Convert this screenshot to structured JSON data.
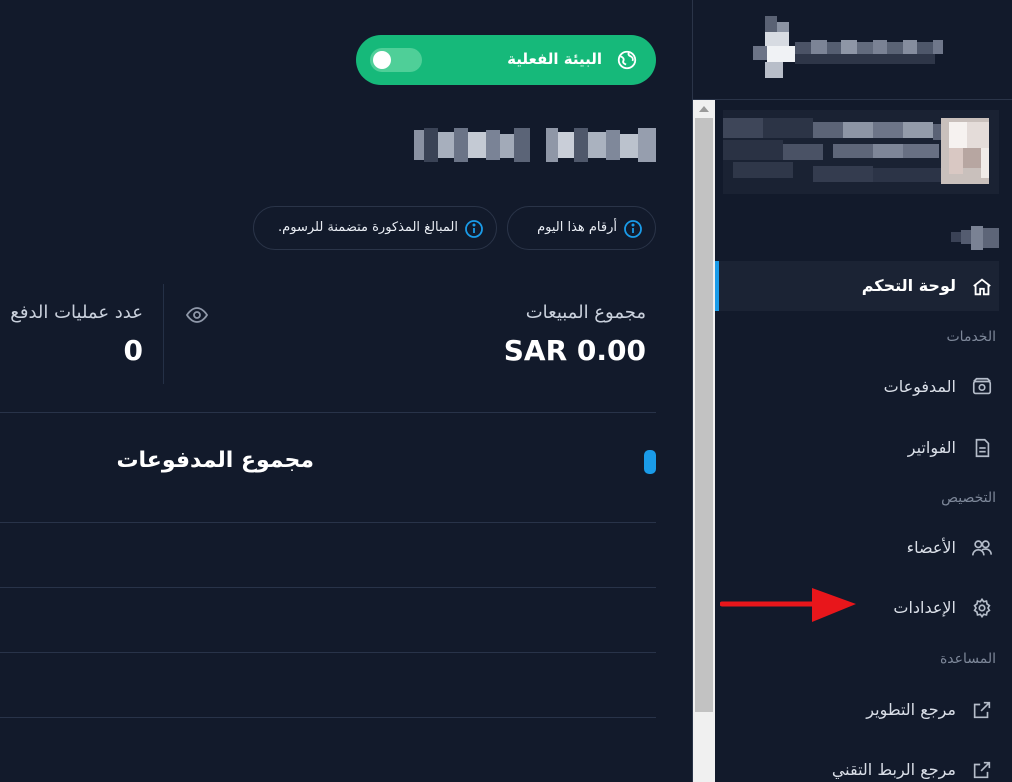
{
  "environment": {
    "label": "البيئة الفعلية",
    "toggle_on": false
  },
  "info_chips": [
    {
      "text": "أرقام هذا اليوم"
    },
    {
      "text": "المبالغ المذكورة متضمنة للرسوم."
    }
  ],
  "stats": {
    "sales_label": "مجموع المبيعات",
    "sales_value": "SAR 0.00",
    "count_label": "عدد عمليات الدفع",
    "count_value": "0"
  },
  "payments_section": {
    "title": "مجموع المدفوعات"
  },
  "sidebar": {
    "items": [
      {
        "label": "لوحة التحكم",
        "icon": "home-icon",
        "active": true
      },
      {
        "section": "الخدمات"
      },
      {
        "label": "المدفوعات",
        "icon": "payments-icon"
      },
      {
        "label": "الفواتير",
        "icon": "invoice-icon"
      },
      {
        "section": "التخصيص"
      },
      {
        "label": "الأعضاء",
        "icon": "members-icon"
      },
      {
        "label": "الإعدادات",
        "icon": "gear-icon"
      },
      {
        "section": "المساعدة"
      },
      {
        "label": "مرجع التطوير",
        "icon": "external-link-icon"
      },
      {
        "label": "مرجع الربط التقني",
        "icon": "external-link-icon"
      }
    ]
  },
  "colors": {
    "background": "#121a2b",
    "accent_green": "#16b97a",
    "accent_blue": "#1a9be8",
    "annotation_red": "#e8161b"
  }
}
